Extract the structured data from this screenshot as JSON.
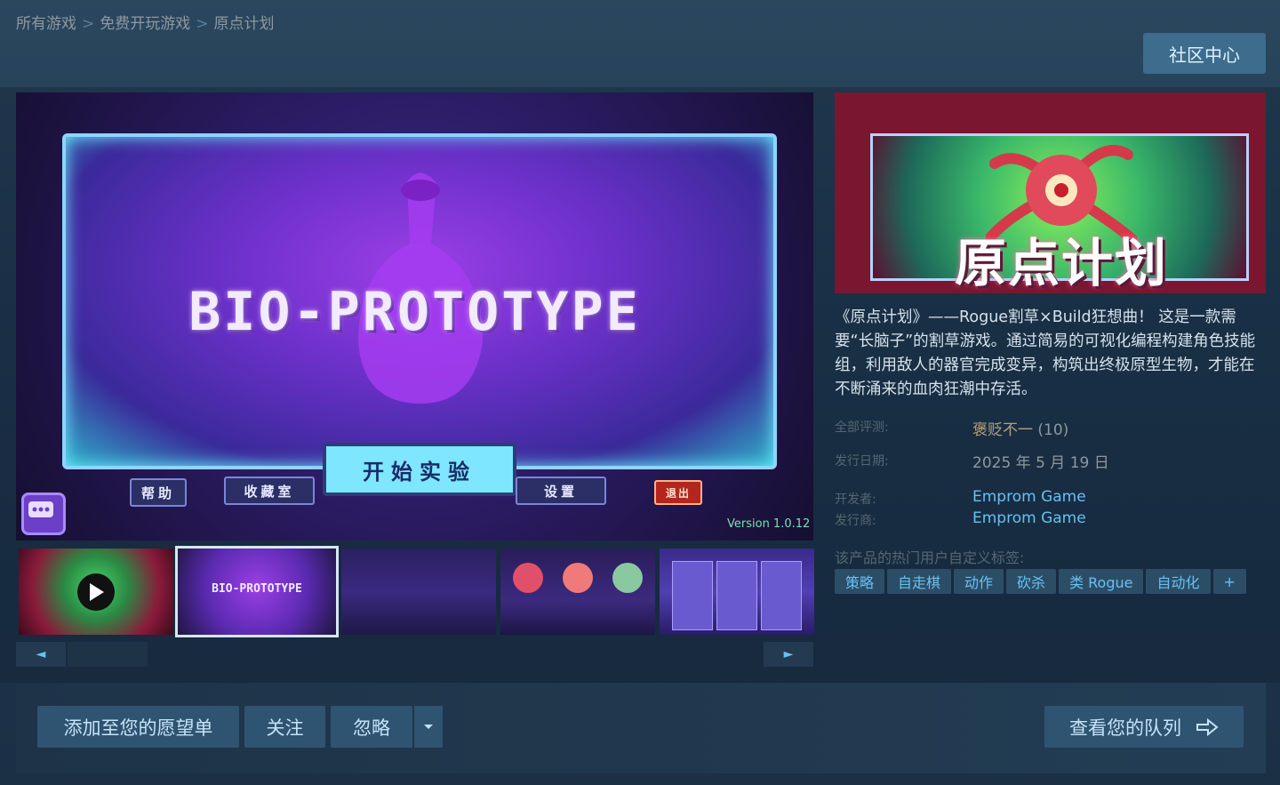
{
  "breadcrumb": {
    "items": [
      "所有游戏",
      "免费开玩游戏",
      "原点计划"
    ],
    "separator": ">"
  },
  "header": {
    "community_label": "社区中心"
  },
  "media": {
    "game_title": "BIO-PROTOTYPE",
    "version": "Version 1.0.12",
    "buttons": {
      "help": "帮助",
      "collection": "收藏室",
      "start": "开始实验",
      "settings": "设置",
      "exit": "退出"
    },
    "thumbnails": [
      {
        "kind": "video",
        "icon": "play-icon"
      },
      {
        "kind": "image",
        "caption": "BIO-PROTOTYPE",
        "selected": true
      },
      {
        "kind": "image"
      },
      {
        "kind": "image"
      },
      {
        "kind": "image"
      }
    ],
    "scroll": {
      "left_icon": "◄",
      "right_icon": "►"
    }
  },
  "capsule": {
    "title": "原点计划"
  },
  "info": {
    "description": "《原点计划》——Rogue割草×Build狂想曲！ 这是一款需要“长脑子”的割草游戏。通过简易的可视化编程构建角色技能组，利用敌人的器官完成变异，构筑出终极原型生物，才能在不断涌来的血肉狂潮中存活。",
    "reviews_label": "全部评测:",
    "reviews_value": "褒贬不一",
    "reviews_count": "(10)",
    "release_label": "发行日期:",
    "release_value": "2025 年 5 月 19 日",
    "developer_label": "开发者:",
    "developer_value": "Emprom Game",
    "publisher_label": "发行商:",
    "publisher_value": "Emprom Game",
    "tags_title": "该产品的热门用户自定义标签:",
    "tags": [
      "策略",
      "自走棋",
      "动作",
      "砍杀",
      "类 Rogue",
      "自动化",
      "+"
    ]
  },
  "actions": {
    "wishlist": "添加至您的愿望单",
    "follow": "关注",
    "ignore": "忽略",
    "queue": "查看您的队列"
  },
  "colors": {
    "background": "#1b2838",
    "link": "#66c0f4",
    "review_mixed": "#b9a074",
    "button": "#2f5471"
  }
}
